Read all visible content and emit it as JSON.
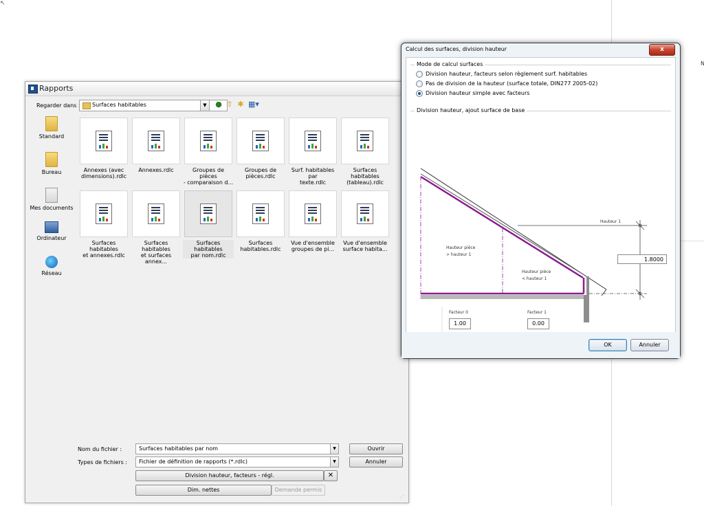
{
  "rapports": {
    "title": "Rapports",
    "look_in_label": "Regarder dans :",
    "look_in_value": "Surfaces habitables",
    "places": [
      {
        "label": "Standard",
        "icon": "folder-icon"
      },
      {
        "label": "Bureau",
        "icon": "folder-icon"
      },
      {
        "label": "Mes documents",
        "icon": "documents-icon"
      },
      {
        "label": "Ordinateur",
        "icon": "computer-icon"
      },
      {
        "label": "Réseau",
        "icon": "network-icon"
      }
    ],
    "files": [
      {
        "line1": "Annexes (avec",
        "line2": "dimensions).rdlc"
      },
      {
        "line1": "Annexes.rdlc",
        "line2": ""
      },
      {
        "line1": "Groupes de pièces",
        "line2": "- comparaison d..."
      },
      {
        "line1": "Groupes de",
        "line2": "pièces.rdlc"
      },
      {
        "line1": "Surf. habitables par",
        "line2": "texte.rdlc"
      },
      {
        "line1": "Surfaces habitables",
        "line2": "(tableau).rdlc"
      },
      {
        "line1": "Surfaces habitables",
        "line2": "et annexes.rdlc"
      },
      {
        "line1": "Surfaces habitables",
        "line2": "et surfaces annex..."
      },
      {
        "line1": "Surfaces habitables",
        "line2": "par nom.rdlc"
      },
      {
        "line1": "Surfaces",
        "line2": "habitables.rdlc"
      },
      {
        "line1": "Vue d'ensemble",
        "line2": "groupes de pi..."
      },
      {
        "line1": "Vue d'ensemble",
        "line2": "surface habita..."
      }
    ],
    "filename_label": "Nom du fichier :",
    "filename_value": "Surfaces habitables par nom",
    "filetype_label": "Types de fichiers :",
    "filetype_value": "Fichier de définition de rapports (*.rdlc)",
    "open_label": "Ouvrir",
    "cancel_label": "Annuler",
    "division_button_label": "Division hauteur, facteurs - régl.",
    "dim_nettes_label": "Dim. nettes",
    "demande_permis_label": "Demande permis"
  },
  "calc": {
    "title": "Calcul des surfaces, division hauteur",
    "close_glyph": "x",
    "mode_group_title": "Mode de calcul surfaces",
    "options": [
      "Division hauteur, facteurs selon règlement surf. habitables",
      "Pas de division de la hauteur (surface totale, DIN277 2005-02)",
      "Division hauteur simple avec facteurs"
    ],
    "selected_option": 2,
    "division_group_title": "Division hauteur, ajout surface de base",
    "diagram": {
      "hauteur1_label": "Hauteur 1",
      "hauteur1_value": "1.8000",
      "hauteur_piece_gt_1": "Hauteur pièce",
      "hauteur_piece_gt_2": "> hauteur 1",
      "hauteur_piece_lt_1": "Hauteur pièce",
      "hauteur_piece_lt_2": "< hauteur 1",
      "facteur0_label": "Facteur 0",
      "facteur0_value": "1.00",
      "facteur1_label": "Facteur 1",
      "facteur1_value": "0.00"
    },
    "ok_label": "OK",
    "cancel_label": "Annuler"
  },
  "background": {
    "side_mark": "N"
  },
  "colors": {
    "accent_purple": "#8b1a8f",
    "close_red": "#c8442f"
  }
}
